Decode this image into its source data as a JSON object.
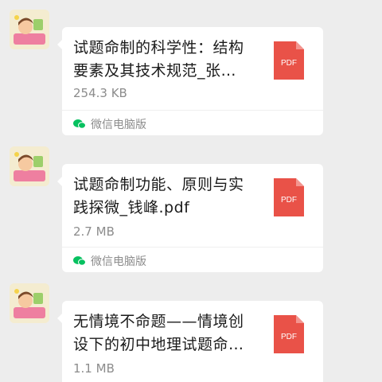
{
  "messages": [
    {
      "title": "试题命制的科学性：结构要素及其技术规范_张…",
      "size": "254.3 KB",
      "badge": "PDF",
      "source": "微信电脑版",
      "avatar_icon": "cartoon-avatar-icon",
      "file_icon": "pdf-file-icon"
    },
    {
      "title": "试题命制功能、原则与实践探微_钱峰.pdf",
      "size": "2.7 MB",
      "badge": "PDF",
      "source": "微信电脑版",
      "avatar_icon": "cartoon-avatar-icon",
      "file_icon": "pdf-file-icon"
    },
    {
      "title": "无情境不命题——情境创设下的初中地理试题命…",
      "size": "1.1 MB",
      "badge": "PDF",
      "avatar_icon": "cartoon-avatar-icon",
      "file_icon": "pdf-file-icon"
    }
  ],
  "colors": {
    "pdf_red": "#e95248",
    "wechat_green": "#07c160",
    "background": "#ededed"
  }
}
